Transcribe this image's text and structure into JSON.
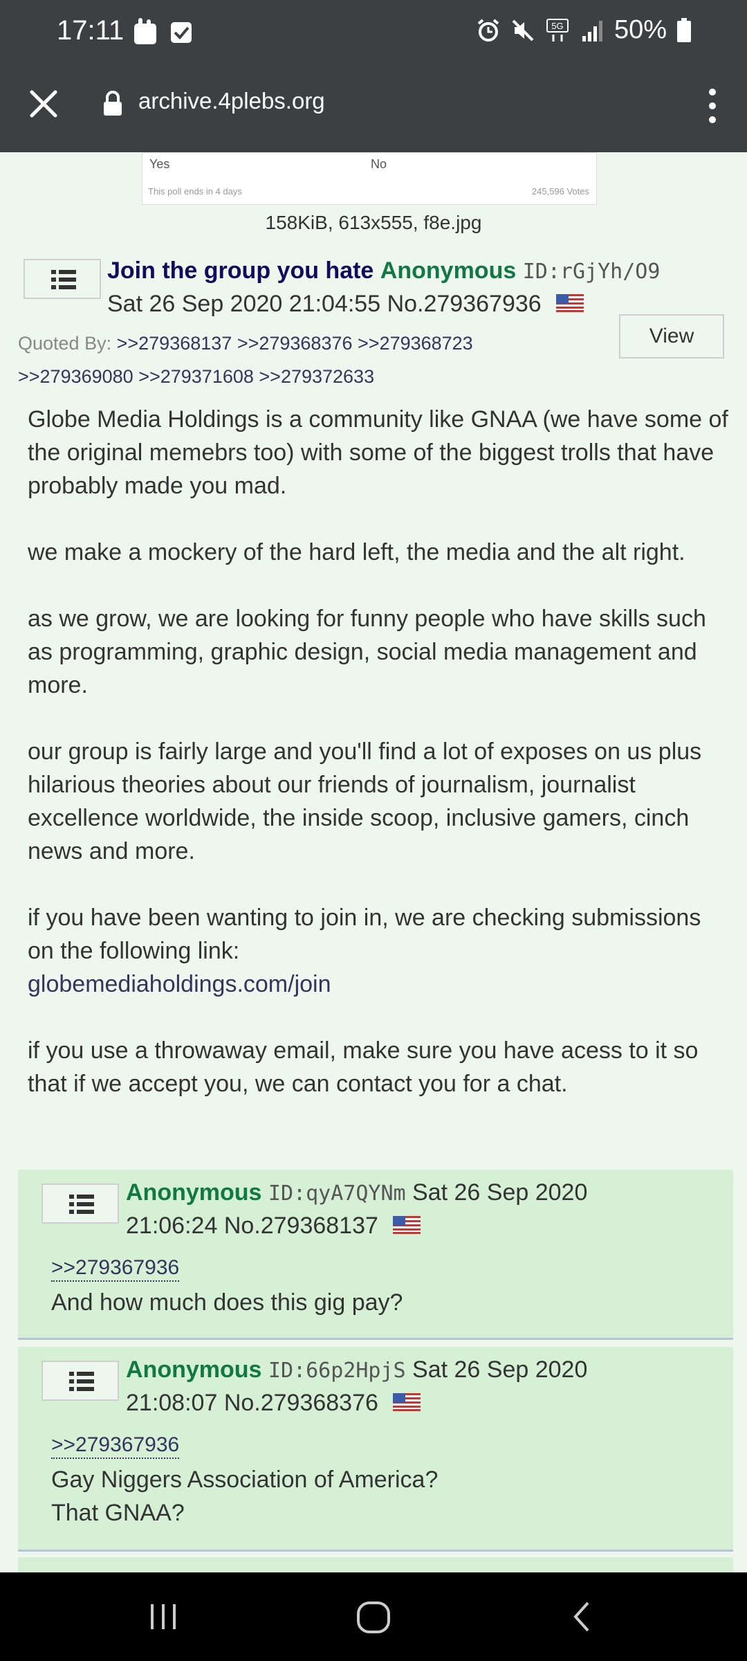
{
  "status_bar": {
    "time": "17:11",
    "battery": "50%",
    "icons": [
      "slack-notification-icon",
      "checkbox-notification-icon",
      "alarm-icon",
      "mute-icon",
      "5g-icon",
      "signal-icon",
      "battery-icon"
    ]
  },
  "url_bar": {
    "url": "archive.4plebs.org",
    "icons": [
      "close-icon",
      "lock-icon",
      "more-vert-icon"
    ]
  },
  "poll_image": {
    "option1": "Yes",
    "option2": "No",
    "footer_left": "This poll ends in 4 days",
    "footer_right": "245,596 Votes"
  },
  "op": {
    "file_info": "158KiB, 613x555, f8e.jpg",
    "subject": "Join the group you hate",
    "name": "Anonymous",
    "id": "ID:rGjYh/O9",
    "date": "Sat 26 Sep 2020 21:04:55",
    "number": "No.279367936",
    "quoted_by_label": "Quoted By:",
    "quoted_by": [
      ">>279368137",
      ">>279368376",
      ">>279368723",
      ">>279369080",
      ">>279371608",
      ">>279372633"
    ],
    "view_label": "View",
    "paragraphs": [
      "Globe Media Holdings is a community like GNAA (we have some of the original memebrs too) with some of the biggest trolls that have probably made you mad.",
      "we make a mockery of the hard left, the media and the alt right.",
      "as we grow, we are looking for funny people who have skills such as programming, graphic design, social media management and more.",
      "our group is fairly large and you'll find a lot of exposes on us plus hilarious theories about our friends of journalism, journalist excellence worldwide, the inside scoop, inclusive gamers, cinch news and more.",
      "if you have been wanting to join in, we are checking submissions on the following link:",
      "if you use a throwaway email, make sure you have acess to it so that if we accept you, we can contact you for a chat."
    ],
    "link": "globemediaholdings.com/join"
  },
  "replies": [
    {
      "name": "Anonymous",
      "id": "ID:qyA7QYNm",
      "date_part1": "Sat 26 Sep 2020",
      "date_part2": "21:06:24",
      "number": "No.279368137",
      "quote": ">>279367936",
      "text_lines": [
        "And how much does this gig pay?"
      ]
    },
    {
      "name": "Anonymous",
      "id": "ID:66p2HpjS",
      "date_part1": "Sat 26 Sep 2020",
      "date_part2": "21:08:07",
      "number": "No.279368376",
      "quote": ">>279367936",
      "text_lines": [
        "Gay Niggers Association of America?",
        "That GNAA?"
      ]
    }
  ],
  "nav_bar": {
    "icons": [
      "recent-apps-icon",
      "home-icon",
      "back-icon"
    ]
  }
}
